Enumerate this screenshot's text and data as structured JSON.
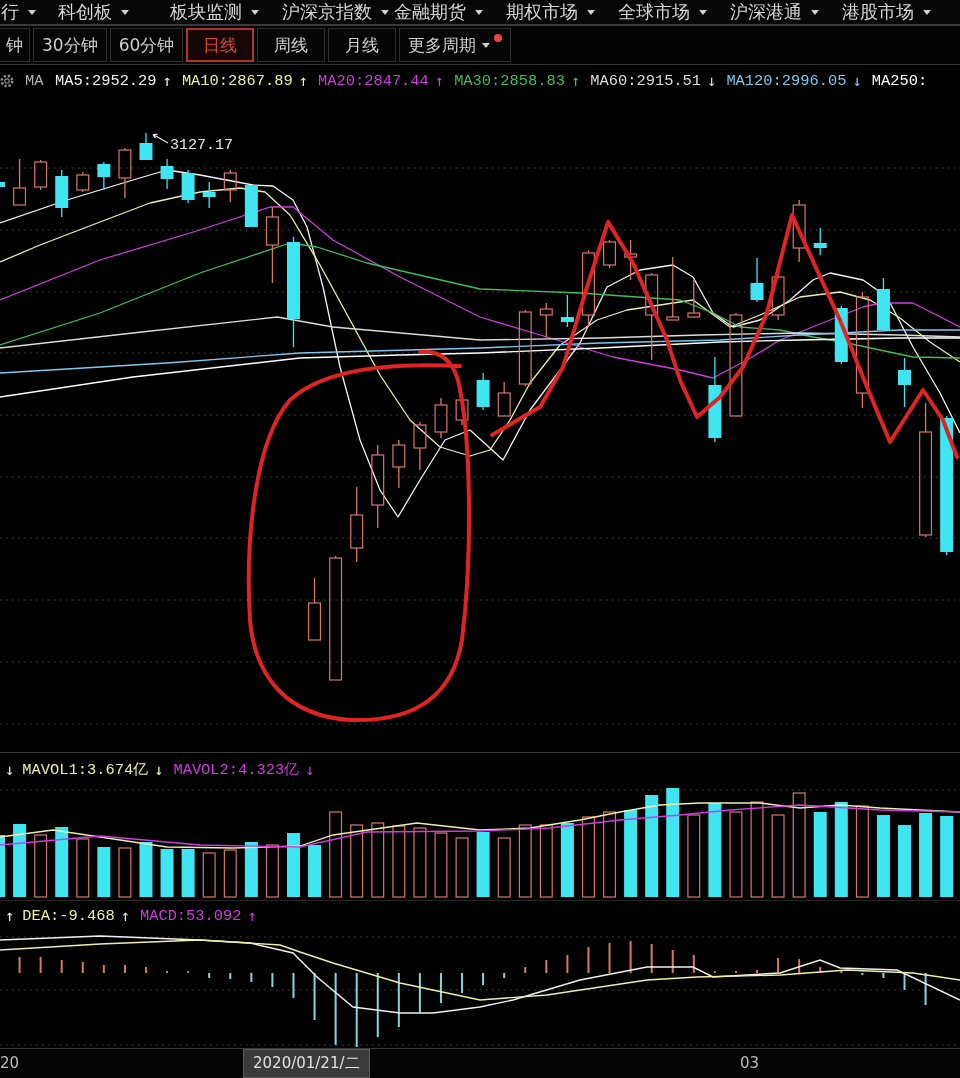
{
  "market_menu": {
    "items": [
      {
        "label": "行"
      },
      {
        "label": "科创板"
      },
      {
        "label": "板块监测"
      },
      {
        "label": "沪深京指数"
      },
      {
        "label": "金融期货"
      },
      {
        "label": "期权市场"
      },
      {
        "label": "全球市场"
      },
      {
        "label": "沪深港通"
      },
      {
        "label": "港股市场"
      }
    ]
  },
  "period_tabs": [
    {
      "label": "钟",
      "kind": "period",
      "selected": false
    },
    {
      "label": "30分钟",
      "kind": "period",
      "selected": false
    },
    {
      "label": "60分钟",
      "kind": "period",
      "selected": false
    },
    {
      "label": "日线",
      "kind": "period",
      "selected": true
    },
    {
      "label": "周线",
      "kind": "period",
      "selected": false
    },
    {
      "label": "月线",
      "kind": "period",
      "selected": false
    },
    {
      "label": "更多周期",
      "kind": "dropdown",
      "selected": false,
      "alert": true
    }
  ],
  "ma_legend": {
    "title": "MA",
    "items": [
      {
        "label": "MA5:2952.29",
        "arrow": "↑",
        "color": "#f2f2f2"
      },
      {
        "label": "MA10:2867.89",
        "arrow": "↑",
        "color": "#eeeeaa"
      },
      {
        "label": "MA20:2847.44",
        "arrow": "↑",
        "color": "#d03ce0"
      },
      {
        "label": "MA30:2858.83",
        "arrow": "↑",
        "color": "#3fbf5a"
      },
      {
        "label": "MA60:2915.51",
        "arrow": "↓",
        "color": "#dcdcdc"
      },
      {
        "label": "MA120:2996.05",
        "arrow": "↓",
        "color": "#7ec8ee"
      },
      {
        "label": "MA250:",
        "color": "#ffffff"
      }
    ]
  },
  "price_chart": {
    "peak_label": "3127.17"
  },
  "volume_legend": {
    "lead_arrow": "↓",
    "items": [
      {
        "label": "MAVOL1:3.674亿",
        "arrow": "↓",
        "color": "#eeeeaa"
      },
      {
        "label": "MAVOL2:4.323亿",
        "arrow": "↓",
        "color": "#d03ce0"
      }
    ]
  },
  "macd_legend": {
    "lead_arrow": "↑",
    "items": [
      {
        "label": "DEA:-9.468",
        "arrow": "↑",
        "color": "#eeeeaa"
      },
      {
        "label": "MACD:53.092",
        "arrow": "↑",
        "color": "#d03ce0"
      }
    ]
  },
  "time_axis": {
    "labels": [
      {
        "label": "20",
        "kind": "tick"
      },
      {
        "label": "2020/01/21/二",
        "kind": "cursor"
      },
      {
        "label": "03",
        "kind": "tick"
      }
    ]
  }
}
